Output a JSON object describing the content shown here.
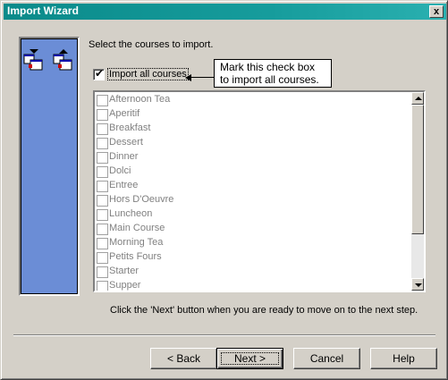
{
  "window": {
    "title": "Import Wizard",
    "close_glyph": "x"
  },
  "prompt": "Select the courses to import.",
  "import_all": {
    "label": "Import all courses",
    "checked": true
  },
  "callout": {
    "line1": "Mark this check box",
    "line2": "to import all courses."
  },
  "courses": [
    "Afternoon Tea",
    "Aperitif",
    "Breakfast",
    "Dessert",
    "Dinner",
    "Dolci",
    "Entree",
    "Hors D'Oeuvre",
    "Luncheon",
    "Main Course",
    "Morning Tea",
    "Petits Fours",
    "Starter",
    "Supper"
  ],
  "hint": "Click the 'Next' button when you are ready to move on to the next step.",
  "buttons": {
    "back": "< Back",
    "next": "Next >",
    "cancel": "Cancel",
    "help": "Help"
  }
}
